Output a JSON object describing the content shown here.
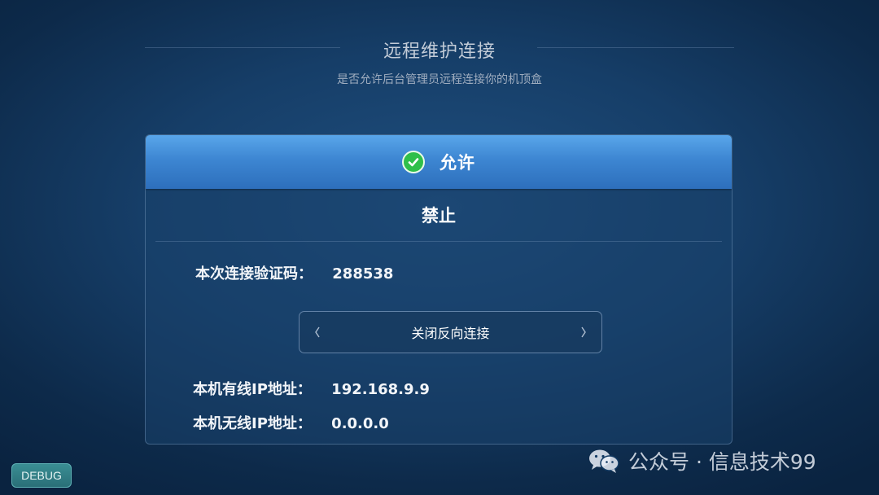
{
  "header": {
    "title": "远程维护连接",
    "subtitle": "是否允许后台管理员远程连接你的机顶盒"
  },
  "options": {
    "allow_label": "允许",
    "deny_label": "禁止",
    "selected": "allow"
  },
  "verification": {
    "label": "本次连接验证码：",
    "code": "288538"
  },
  "reverse_connection": {
    "value": "关闭反向连接"
  },
  "network": {
    "wired_label": "本机有线IP地址：",
    "wired_ip": "192.168.9.9",
    "wireless_label": "本机无线IP地址：",
    "wireless_ip": "0.0.0.0"
  },
  "debug_label": "DEBUG",
  "watermark": {
    "icon": "wechat-icon",
    "text": "公众号 · 信息技术99"
  },
  "colors": {
    "accent": "#3d86d2",
    "check": "#2fbf4a"
  }
}
